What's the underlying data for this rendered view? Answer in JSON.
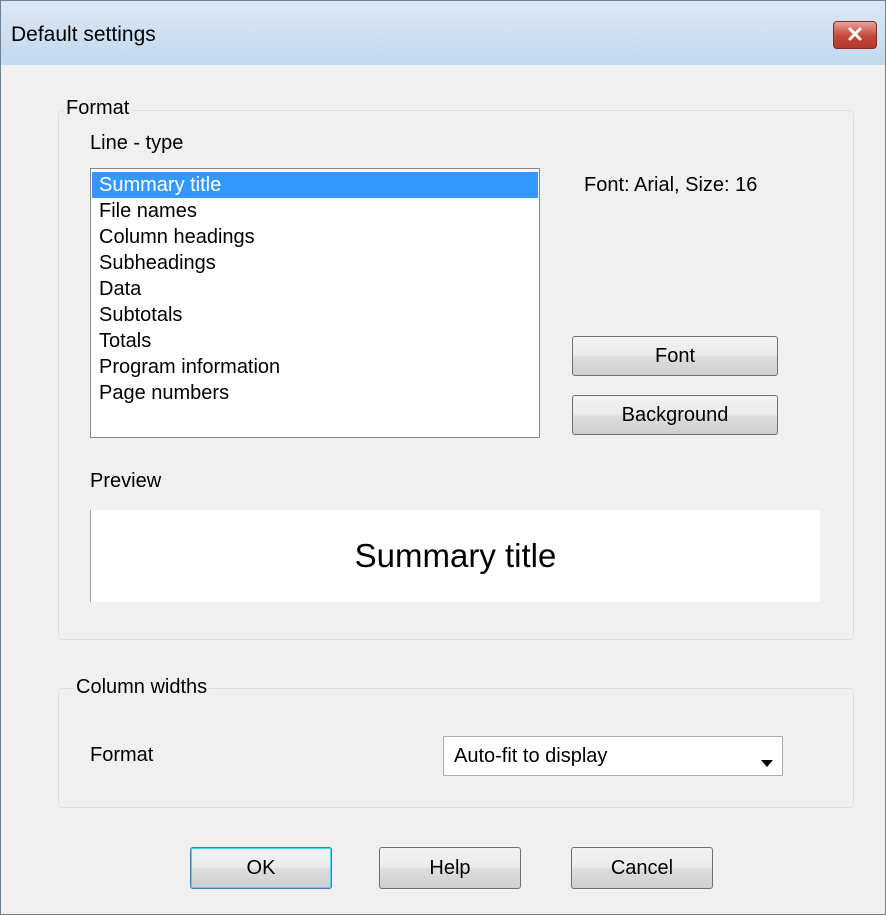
{
  "window": {
    "title": "Default settings",
    "close_icon": "close-icon"
  },
  "format_group": {
    "legend": "Format",
    "line_type_label": "Line - type",
    "line_types": [
      "Summary title",
      "File names",
      "Column headings",
      "Subheadings",
      "Data",
      "Subtotals",
      "Totals",
      "Program information",
      "Page numbers"
    ],
    "selected_index": 0,
    "font_info": "Font: Arial, Size: 16",
    "font_button": "Font",
    "background_button": "Background",
    "preview_label": "Preview",
    "preview_text": "Summary title"
  },
  "column_widths_group": {
    "legend": "Column widths",
    "format_label": "Format",
    "format_value": "Auto-fit to display"
  },
  "footer": {
    "ok": "OK",
    "help": "Help",
    "cancel": "Cancel"
  },
  "colors": {
    "selection": "#3399ff",
    "close_button": "#c3483a",
    "titlebar": "#c4d8ee"
  }
}
